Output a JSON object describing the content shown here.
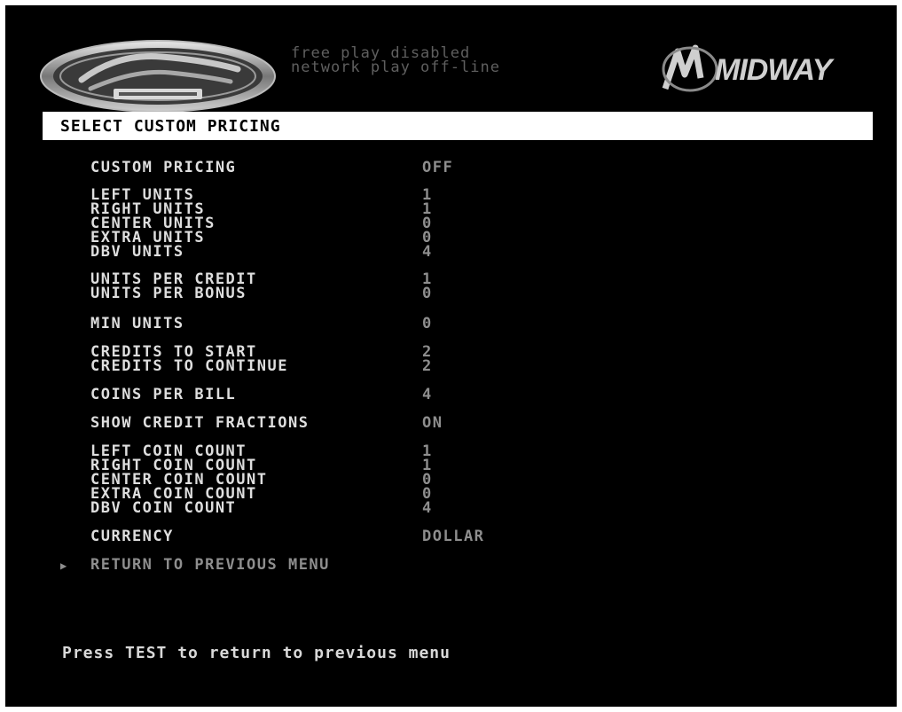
{
  "header": {
    "status_line1": "free play disabled",
    "status_line2": "network play off-line",
    "game_logo_icon": "hydro-thunder-logo",
    "brand_logo_icon": "midway-logo",
    "brand_text": "MIDWAY"
  },
  "title": "SELECT CUSTOM PRICING",
  "menu": {
    "custom_pricing": {
      "label": "CUSTOM PRICING",
      "value": "OFF"
    },
    "left_units": {
      "label": "LEFT UNITS",
      "value": "1"
    },
    "right_units": {
      "label": "RIGHT UNITS",
      "value": "1"
    },
    "center_units": {
      "label": "CENTER UNITS",
      "value": "0"
    },
    "extra_units": {
      "label": "EXTRA UNITS",
      "value": "0"
    },
    "dbv_units": {
      "label": "DBV UNITS",
      "value": "4"
    },
    "units_per_credit": {
      "label": "UNITS PER CREDIT",
      "value": "1"
    },
    "units_per_bonus": {
      "label": "UNITS PER BONUS",
      "value": "0"
    },
    "min_units": {
      "label": "MIN UNITS",
      "value": "0"
    },
    "credits_to_start": {
      "label": "CREDITS TO START",
      "value": "2"
    },
    "credits_to_continue": {
      "label": "CREDITS TO CONTINUE",
      "value": "2"
    },
    "coins_per_bill": {
      "label": "COINS PER BILL",
      "value": "4"
    },
    "show_credit_fractions": {
      "label": "SHOW CREDIT FRACTIONS",
      "value": "ON"
    },
    "left_coin_count": {
      "label": "LEFT COIN COUNT",
      "value": "1"
    },
    "right_coin_count": {
      "label": "RIGHT COIN COUNT",
      "value": "1"
    },
    "center_coin_count": {
      "label": "CENTER COIN COUNT",
      "value": "0"
    },
    "extra_coin_count": {
      "label": "EXTRA COIN COUNT",
      "value": "0"
    },
    "dbv_coin_count": {
      "label": "DBV COIN COUNT",
      "value": "4"
    },
    "currency": {
      "label": "CURRENCY",
      "value": "DOLLAR"
    },
    "return": {
      "label": "RETURN TO PREVIOUS MENU",
      "pointer_icon": "triangle-right-icon"
    }
  },
  "footer": "Press TEST to return to previous menu",
  "colors": {
    "background": "#000000",
    "label": "#dedede",
    "value": "#8e8e8e",
    "title_bar": "#ffffff"
  }
}
